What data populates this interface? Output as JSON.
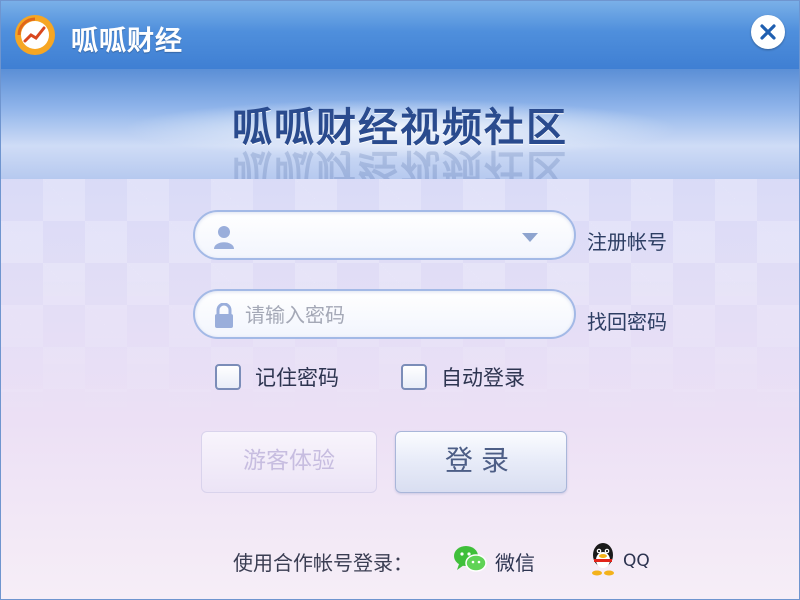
{
  "window": {
    "title": "呱呱财经",
    "close_icon": "close-icon"
  },
  "banner": {
    "title": "呱呱财经视频社区"
  },
  "login": {
    "username": {
      "value": "",
      "placeholder": "",
      "icon": "user-icon"
    },
    "password": {
      "value": "",
      "placeholder": "请输入密码",
      "icon": "lock-icon"
    },
    "register_link": "注册帐号",
    "recover_link": "找回密码",
    "remember_password": {
      "label": "记住密码",
      "checked": false
    },
    "auto_login": {
      "label": "自动登录",
      "checked": false
    },
    "guest_button": "游客体验",
    "login_button": "登录"
  },
  "partner_login": {
    "label": "使用合作帐号登录：",
    "wechat": {
      "label": "微信",
      "icon": "wechat-icon"
    },
    "qq": {
      "label": "QQ",
      "icon": "qq-icon"
    }
  },
  "colors": {
    "titlebar": "#4f8fdc",
    "banner_text": "#2a4b8e",
    "field_border": "#a3b9e6",
    "wechat_green": "#3fbf3a"
  }
}
